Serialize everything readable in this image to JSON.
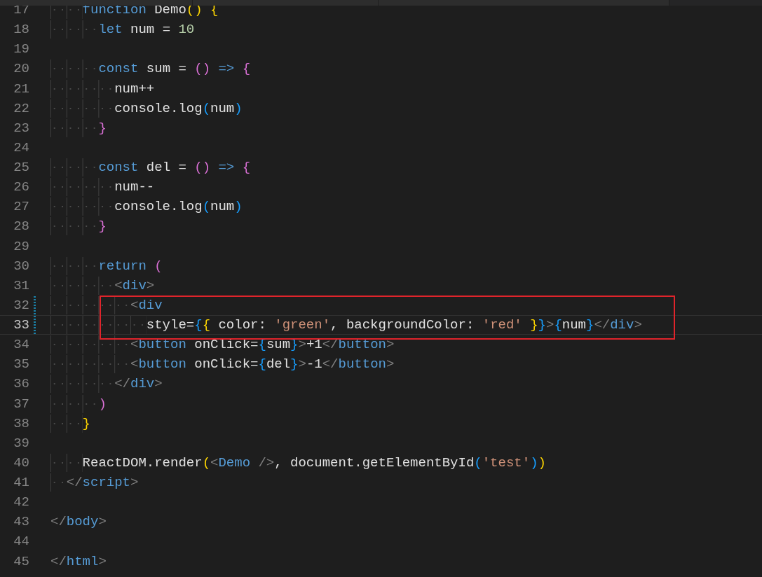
{
  "lines": [
    {
      "number": "17",
      "current": false,
      "modified": false,
      "boxed": false,
      "tokens": [
        {
          "text": "    function",
          "kind": "kw"
        },
        {
          "text": " Demo",
          "kind": "plain"
        },
        {
          "text": "()",
          "kind": "b1"
        },
        {
          "text": " {",
          "kind": "b1"
        }
      ]
    },
    {
      "number": "18",
      "current": false,
      "modified": false,
      "boxed": false,
      "tokens": [
        {
          "text": "      let",
          "kind": "kw"
        },
        {
          "text": " num = ",
          "kind": "plain"
        },
        {
          "text": "10",
          "kind": "num"
        }
      ]
    },
    {
      "number": "19",
      "current": false,
      "modified": false,
      "boxed": false
    },
    {
      "number": "20",
      "current": false,
      "modified": false,
      "boxed": false,
      "tokens": [
        {
          "text": "      const",
          "kind": "kw"
        },
        {
          "text": " sum = ",
          "kind": "plain"
        },
        {
          "text": "()",
          "kind": "b2"
        },
        {
          "text": " =>",
          "kind": "kw"
        },
        {
          "text": " {",
          "kind": "b2"
        }
      ]
    },
    {
      "number": "21",
      "current": false,
      "modified": false,
      "boxed": false,
      "tokens": [
        {
          "text": "        num++",
          "kind": "plain"
        }
      ]
    },
    {
      "number": "22",
      "current": false,
      "modified": false,
      "boxed": false,
      "tokens": [
        {
          "text": "        console.log",
          "kind": "plain"
        },
        {
          "text": "(",
          "kind": "b3"
        },
        {
          "text": "num",
          "kind": "plain"
        },
        {
          "text": ")",
          "kind": "b3"
        }
      ]
    },
    {
      "number": "23",
      "current": false,
      "modified": false,
      "boxed": false,
      "tokens": [
        {
          "text": "      }",
          "kind": "b2"
        }
      ]
    },
    {
      "number": "24",
      "current": false,
      "modified": false,
      "boxed": false
    },
    {
      "number": "25",
      "current": false,
      "modified": false,
      "boxed": false,
      "tokens": [
        {
          "text": "      const",
          "kind": "kw"
        },
        {
          "text": " del = ",
          "kind": "plain"
        },
        {
          "text": "()",
          "kind": "b2"
        },
        {
          "text": " =>",
          "kind": "kw"
        },
        {
          "text": " {",
          "kind": "b2"
        }
      ]
    },
    {
      "number": "26",
      "current": false,
      "modified": false,
      "boxed": false,
      "tokens": [
        {
          "text": "        num--",
          "kind": "plain"
        }
      ]
    },
    {
      "number": "27",
      "current": false,
      "modified": false,
      "boxed": false,
      "tokens": [
        {
          "text": "        console.log",
          "kind": "plain"
        },
        {
          "text": "(",
          "kind": "b3"
        },
        {
          "text": "num",
          "kind": "plain"
        },
        {
          "text": ")",
          "kind": "b3"
        }
      ]
    },
    {
      "number": "28",
      "current": false,
      "modified": false,
      "boxed": false,
      "tokens": [
        {
          "text": "      }",
          "kind": "b2"
        }
      ]
    },
    {
      "number": "29",
      "current": false,
      "modified": false,
      "boxed": false
    },
    {
      "number": "30",
      "current": false,
      "modified": false,
      "boxed": false,
      "tokens": [
        {
          "text": "      return",
          "kind": "kw"
        },
        {
          "text": " (",
          "kind": "b2"
        }
      ]
    },
    {
      "number": "31",
      "current": false,
      "modified": false,
      "boxed": false,
      "tokens": [
        {
          "text": "        <",
          "kind": "punct"
        },
        {
          "text": "div",
          "kind": "tag"
        },
        {
          "text": ">",
          "kind": "punct"
        }
      ]
    },
    {
      "number": "32",
      "current": false,
      "modified": true,
      "boxed": true,
      "tokens": [
        {
          "text": "          <",
          "kind": "punct"
        },
        {
          "text": "div",
          "kind": "tag"
        }
      ]
    },
    {
      "number": "33",
      "current": true,
      "modified": true,
      "boxed": true,
      "tokens": [
        {
          "text": "            style=",
          "kind": "plain"
        },
        {
          "text": "{",
          "kind": "b3"
        },
        {
          "text": "{",
          "kind": "b1"
        },
        {
          "text": " color: ",
          "kind": "plain"
        },
        {
          "text": "'green'",
          "kind": "str"
        },
        {
          "text": ", backgroundColor: ",
          "kind": "plain"
        },
        {
          "text": "'red'",
          "kind": "str"
        },
        {
          "text": " }",
          "kind": "b1"
        },
        {
          "text": "}",
          "kind": "b3"
        },
        {
          "text": ">",
          "kind": "punct"
        },
        {
          "text": "{",
          "kind": "b3"
        },
        {
          "text": "num",
          "kind": "plain"
        },
        {
          "text": "}",
          "kind": "b3"
        },
        {
          "text": "</",
          "kind": "punct"
        },
        {
          "text": "div",
          "kind": "tag"
        },
        {
          "text": ">",
          "kind": "punct"
        }
      ]
    },
    {
      "number": "34",
      "current": false,
      "modified": false,
      "boxed": false,
      "tokens": [
        {
          "text": "          <",
          "kind": "punct"
        },
        {
          "text": "button",
          "kind": "tag"
        },
        {
          "text": " onClick=",
          "kind": "plain"
        },
        {
          "text": "{",
          "kind": "b3"
        },
        {
          "text": "sum",
          "kind": "plain"
        },
        {
          "text": "}",
          "kind": "b3"
        },
        {
          "text": ">",
          "kind": "punct"
        },
        {
          "text": "+1",
          "kind": "plain"
        },
        {
          "text": "</",
          "kind": "punct"
        },
        {
          "text": "button",
          "kind": "tag"
        },
        {
          "text": ">",
          "kind": "punct"
        }
      ]
    },
    {
      "number": "35",
      "current": false,
      "modified": false,
      "boxed": false,
      "tokens": [
        {
          "text": "          <",
          "kind": "punct"
        },
        {
          "text": "button",
          "kind": "tag"
        },
        {
          "text": " onClick=",
          "kind": "plain"
        },
        {
          "text": "{",
          "kind": "b3"
        },
        {
          "text": "del",
          "kind": "plain"
        },
        {
          "text": "}",
          "kind": "b3"
        },
        {
          "text": ">",
          "kind": "punct"
        },
        {
          "text": "-1",
          "kind": "plain"
        },
        {
          "text": "</",
          "kind": "punct"
        },
        {
          "text": "button",
          "kind": "tag"
        },
        {
          "text": ">",
          "kind": "punct"
        }
      ]
    },
    {
      "number": "36",
      "current": false,
      "modified": false,
      "boxed": false,
      "tokens": [
        {
          "text": "        </",
          "kind": "punct"
        },
        {
          "text": "div",
          "kind": "tag"
        },
        {
          "text": ">",
          "kind": "punct"
        }
      ]
    },
    {
      "number": "37",
      "current": false,
      "modified": false,
      "boxed": false,
      "tokens": [
        {
          "text": "      )",
          "kind": "b2"
        }
      ]
    },
    {
      "number": "38",
      "current": false,
      "modified": false,
      "boxed": false,
      "tokens": [
        {
          "text": "    }",
          "kind": "b1"
        }
      ]
    },
    {
      "number": "39",
      "current": false,
      "modified": false,
      "boxed": false
    },
    {
      "number": "40",
      "current": false,
      "modified": false,
      "boxed": false,
      "tokens": [
        {
          "text": "    ReactDOM.render",
          "kind": "plain"
        },
        {
          "text": "(",
          "kind": "b1"
        },
        {
          "text": "<",
          "kind": "punct"
        },
        {
          "text": "Demo",
          "kind": "tag"
        },
        {
          "text": " />",
          "kind": "punct"
        },
        {
          "text": ", document.getElementById",
          "kind": "plain"
        },
        {
          "text": "(",
          "kind": "b3"
        },
        {
          "text": "'test'",
          "kind": "str"
        },
        {
          "text": ")",
          "kind": "b3"
        },
        {
          "text": ")",
          "kind": "b1"
        }
      ]
    },
    {
      "number": "41",
      "current": false,
      "modified": false,
      "boxed": false,
      "tokens": [
        {
          "text": "  </",
          "kind": "punct"
        },
        {
          "text": "script",
          "kind": "tag"
        },
        {
          "text": ">",
          "kind": "punct"
        }
      ]
    },
    {
      "number": "42",
      "current": false,
      "modified": false,
      "boxed": false
    },
    {
      "number": "43",
      "current": false,
      "modified": false,
      "boxed": false,
      "tokens": [
        {
          "text": "</",
          "kind": "punct"
        },
        {
          "text": "body",
          "kind": "tag"
        },
        {
          "text": ">",
          "kind": "punct"
        }
      ]
    },
    {
      "number": "44",
      "current": false,
      "modified": false,
      "boxed": false
    },
    {
      "number": "45",
      "current": false,
      "modified": false,
      "boxed": false,
      "tokens": [
        {
          "text": "</",
          "kind": "punct"
        },
        {
          "text": "html",
          "kind": "tag"
        },
        {
          "text": ">",
          "kind": "punct"
        }
      ]
    }
  ]
}
